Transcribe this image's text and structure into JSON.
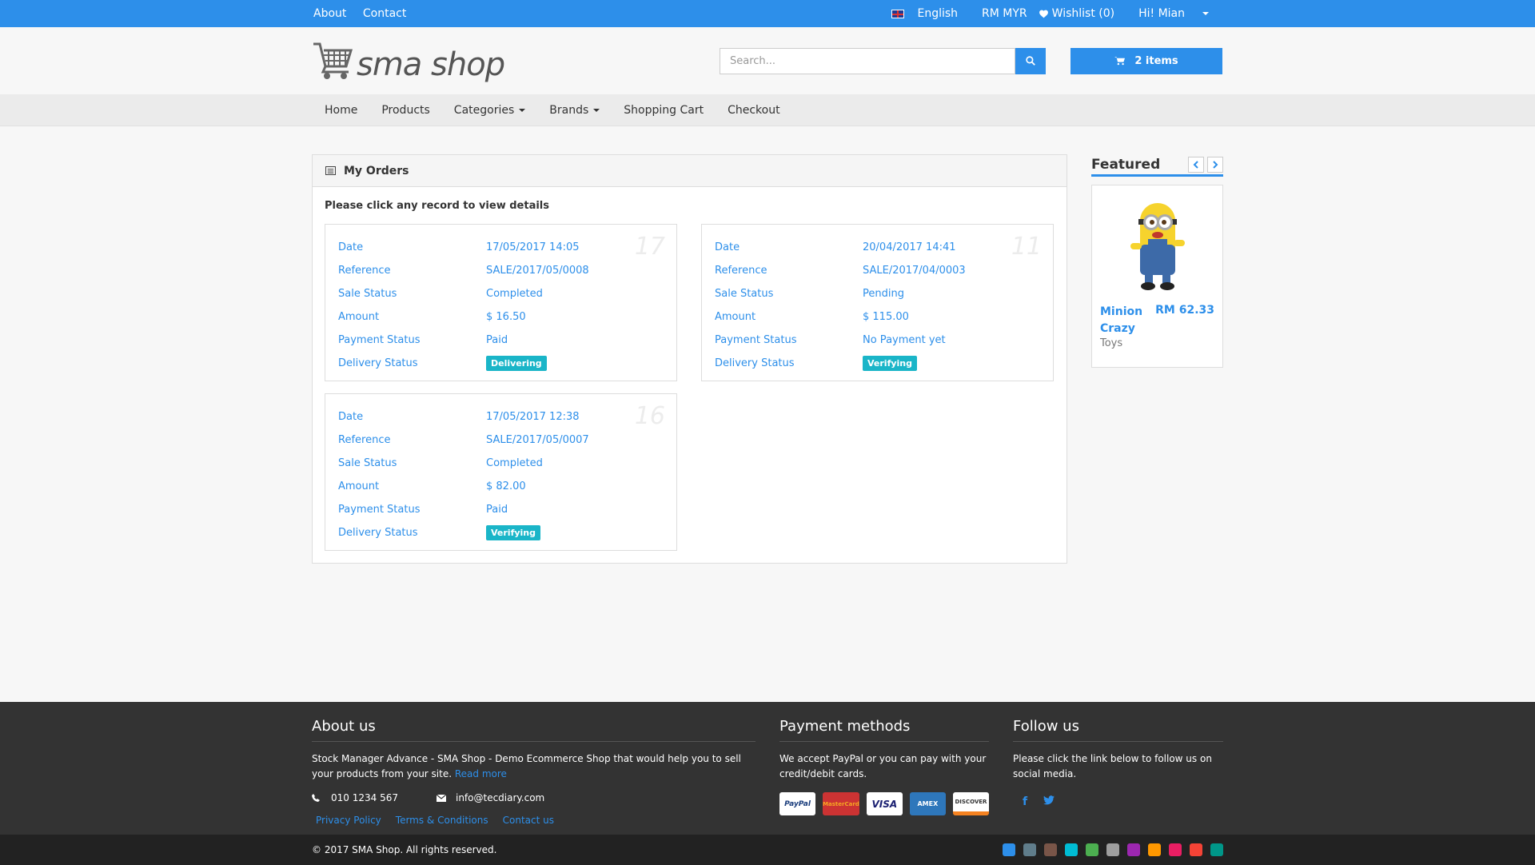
{
  "topbar": {
    "about": "About",
    "contact": "Contact",
    "language": "English",
    "currency": "RM MYR",
    "wishlist": "Wishlist (0)",
    "user": "Hi! Mian"
  },
  "header": {
    "logo_text": "sma shop",
    "search_placeholder": "Search...",
    "cart_label": "2 items"
  },
  "nav": {
    "home": "Home",
    "products": "Products",
    "categories": "Categories",
    "brands": "Brands",
    "shopping_cart": "Shopping Cart",
    "checkout": "Checkout"
  },
  "orders_panel": {
    "title": "My Orders",
    "intro": "Please click any record to view details",
    "labels": {
      "date": "Date",
      "reference": "Reference",
      "sale_status": "Sale Status",
      "amount": "Amount",
      "payment_status": "Payment Status",
      "delivery_status": "Delivery Status"
    },
    "orders": [
      {
        "id": "17",
        "date": "17/05/2017 14:05",
        "reference": "SALE/2017/05/0008",
        "sale_status": "Completed",
        "amount": "$ 16.50",
        "payment_status": "Paid",
        "delivery_status": "Delivering"
      },
      {
        "id": "11",
        "date": "20/04/2017 14:41",
        "reference": "SALE/2017/04/0003",
        "sale_status": "Pending",
        "amount": "$ 115.00",
        "payment_status": "No Payment yet",
        "delivery_status": "Verifying"
      },
      {
        "id": "16",
        "date": "17/05/2017 12:38",
        "reference": "SALE/2017/05/0007",
        "sale_status": "Completed",
        "amount": "$ 82.00",
        "payment_status": "Paid",
        "delivery_status": "Verifying"
      }
    ]
  },
  "featured": {
    "title": "Featured",
    "product_name": "Minion Crazy",
    "price": "RM 62.33",
    "category": "Toys"
  },
  "footer": {
    "about_title": "About us",
    "about_text": "Stock Manager Advance - SMA Shop - Demo Ecommerce Shop that would help you to sell your products from your site.",
    "read_more": "Read more",
    "phone": "010 1234 567",
    "email": "info@tecdiary.com",
    "links": [
      "Privacy Policy",
      "Terms & Conditions",
      "Contact us"
    ],
    "payment_title": "Payment methods",
    "payment_text": "We accept PayPal or you can pay with your credit/debit cards.",
    "payment_cards": [
      "PayPal",
      "MasterCard",
      "VISA",
      "AMEX",
      "DISCOVER"
    ],
    "follow_title": "Follow us",
    "follow_text": "Please click the link below to follow us on social media.",
    "copyright": "© 2017 SMA Shop. All rights reserved."
  },
  "theme_swatches": [
    "#2d8fea",
    "#607d8b",
    "#795548",
    "#00bcd4",
    "#4caf50",
    "#9e9e9e",
    "#9c27b0",
    "#ff9800",
    "#e91e63",
    "#f44336",
    "#009688"
  ]
}
